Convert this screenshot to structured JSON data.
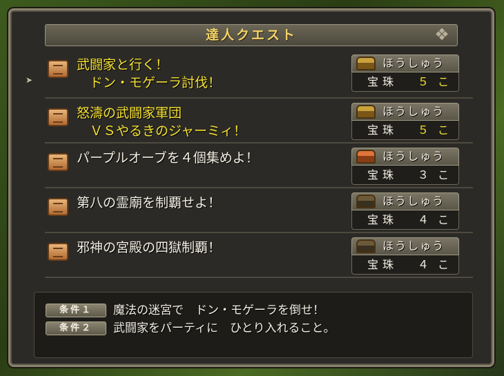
{
  "window": {
    "title": "達人クエスト"
  },
  "quests": [
    {
      "title": "武闘家と行く！\n　ドン・モゲーラ討伐！",
      "highlight": true,
      "chest": "gold-chest-icon",
      "reward_label": "ほうしゅう",
      "reward_item": "宝珠",
      "reward_qty": "５ こ"
    },
    {
      "title": "怒濤の武闘家軍団\n　ＶＳやるきのジャーミィ！",
      "highlight": true,
      "chest": "gold-chest-icon",
      "reward_label": "ほうしゅう",
      "reward_item": "宝珠",
      "reward_qty": "５ こ"
    },
    {
      "title": "パープルオーブを４個集めよ！",
      "highlight": false,
      "chest": "red-chest-icon",
      "reward_label": "ほうしゅう",
      "reward_item": "宝珠",
      "reward_qty": "３ こ"
    },
    {
      "title": "第八の霊廟を制覇せよ！",
      "highlight": false,
      "chest": "dark-chest-icon",
      "reward_label": "ほうしゅう",
      "reward_item": "宝珠",
      "reward_qty": "４ こ"
    },
    {
      "title": "邪神の宮殿の四獄制覇！",
      "highlight": false,
      "chest": "dark-chest-icon",
      "reward_label": "ほうしゅう",
      "reward_item": "宝珠",
      "reward_qty": "４ こ"
    }
  ],
  "conditions": [
    {
      "badge": "条件１",
      "text": "魔法の迷宮で　ドン・モゲーラを倒せ！"
    },
    {
      "badge": "条件２",
      "text": "武闘家をパーティに　ひとり入れること。"
    }
  ],
  "colors": {
    "highlight": "#f6e233",
    "title": "#f3d36a",
    "text": "#f4f0e4"
  }
}
